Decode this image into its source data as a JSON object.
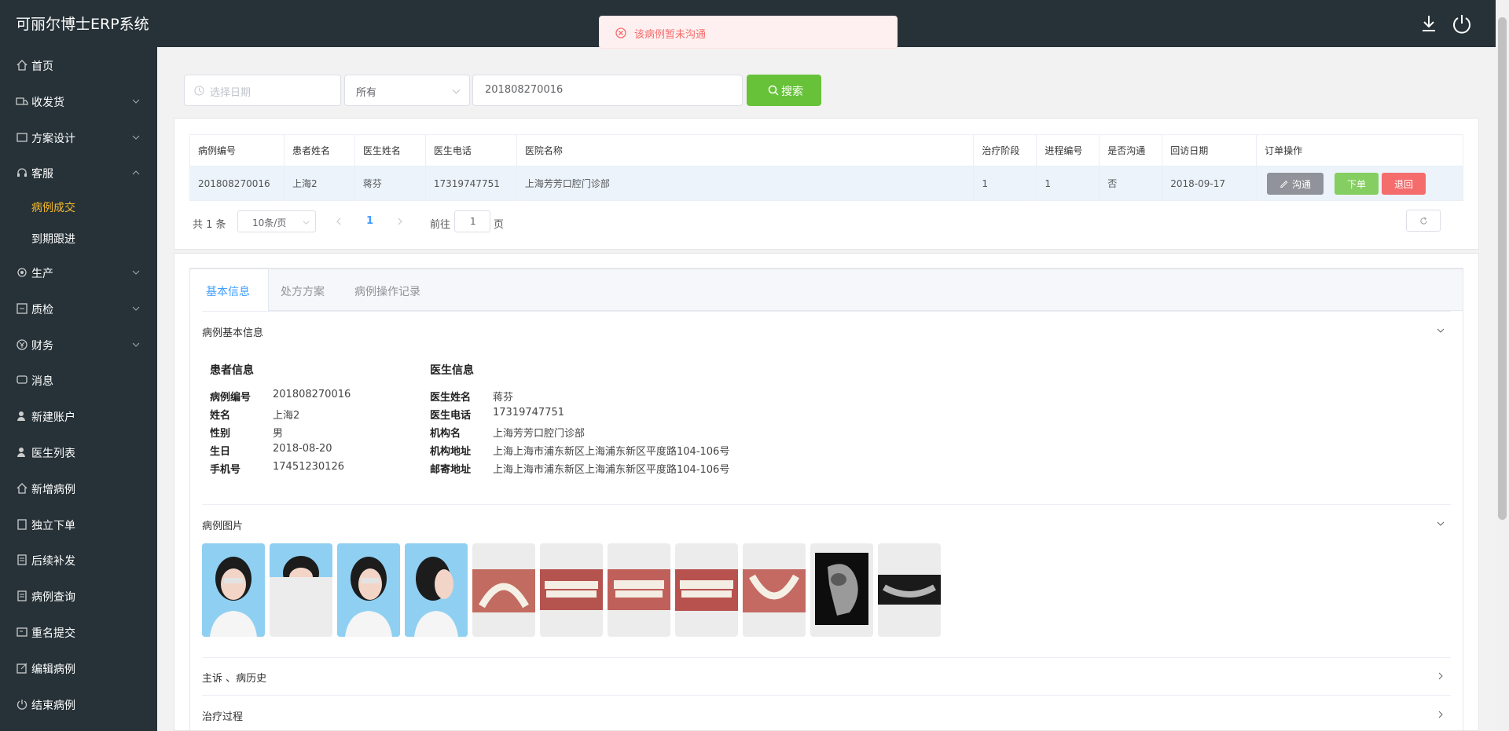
{
  "header": {
    "title": "可丽尔博士ERP系统",
    "download_icon": "download-icon",
    "power_icon": "power-icon"
  },
  "sidebar": {
    "items": [
      {
        "label": "首页",
        "icon": "home-icon"
      },
      {
        "label": "收发货",
        "icon": "truck-icon"
      },
      {
        "label": "方案设计",
        "icon": "design-icon"
      },
      {
        "label": "客服",
        "icon": "headset-icon"
      },
      {
        "label": "生产",
        "icon": "cog-icon"
      },
      {
        "label": "质检",
        "icon": "inspect-icon"
      },
      {
        "label": "财务",
        "icon": "yen-icon"
      },
      {
        "label": "消息",
        "icon": "message-icon"
      },
      {
        "label": "新建账户",
        "icon": "user-add-icon"
      },
      {
        "label": "医生列表",
        "icon": "user-list-icon"
      },
      {
        "label": "新增病例",
        "icon": "home-icon"
      },
      {
        "label": "独立下单",
        "icon": "order-icon"
      },
      {
        "label": "后续补发",
        "icon": "reissue-icon"
      },
      {
        "label": "病例查询",
        "icon": "query-icon"
      },
      {
        "label": "重名提交",
        "icon": "submit-icon"
      },
      {
        "label": "编辑病例",
        "icon": "edit-icon"
      },
      {
        "label": "结束病例",
        "icon": "power-icon"
      }
    ],
    "sub_items": [
      {
        "label": "病例成交"
      },
      {
        "label": "到期跟进"
      }
    ]
  },
  "toast": {
    "message": "该病例暂未沟通"
  },
  "filters": {
    "date_placeholder": "选择日期",
    "status_value": "所有",
    "keyword_value": "201808270016",
    "search_label": "搜索"
  },
  "table": {
    "headers": [
      "病例编号",
      "患者姓名",
      "医生姓名",
      "医生电话",
      "医院名称",
      "治疗阶段",
      "进程编号",
      "是否沟通",
      "回访日期",
      "订单操作"
    ],
    "row": [
      "201808270016",
      "上海2",
      "蒋芬",
      "17319747751",
      "上海芳芳口腔门诊部",
      "1",
      "1",
      "否",
      "2018-09-17"
    ],
    "actions": {
      "communicate": "沟通",
      "order": "下单",
      "return": "退回"
    }
  },
  "pager": {
    "total": "共 1 条",
    "page_size": "10条/页",
    "current": "1",
    "goto_prefix": "前往",
    "goto_value": "1",
    "goto_suffix": "页"
  },
  "tabs": [
    "基本信息",
    "处方方案",
    "病例操作记录"
  ],
  "basic": {
    "section_title": "病例基本信息",
    "patient": {
      "title": "患者信息",
      "rows": [
        {
          "label": "病例编号",
          "value": "201808270016"
        },
        {
          "label": "姓名",
          "value": "上海2"
        },
        {
          "label": "性别",
          "value": "男"
        },
        {
          "label": "生日",
          "value": "2018-08-20"
        },
        {
          "label": "手机号",
          "value": "17451230126"
        }
      ]
    },
    "doctor": {
      "title": "医生信息",
      "rows": [
        {
          "label": "医生姓名",
          "value": "蒋芬"
        },
        {
          "label": "医生电话",
          "value": "17319747751"
        },
        {
          "label": "机构名",
          "value": "上海芳芳口腔门诊部"
        },
        {
          "label": "机构地址",
          "value": "上海上海市浦东新区上海浦东新区平度路104-106号"
        },
        {
          "label": "邮寄地址",
          "value": "上海上海市浦东新区上海浦东新区平度路104-106号"
        }
      ]
    }
  },
  "images_section": {
    "title": "病例图片"
  },
  "complaint_section": {
    "title": "主诉 、病历史"
  },
  "treatment_section": {
    "title": "治疗过程"
  }
}
